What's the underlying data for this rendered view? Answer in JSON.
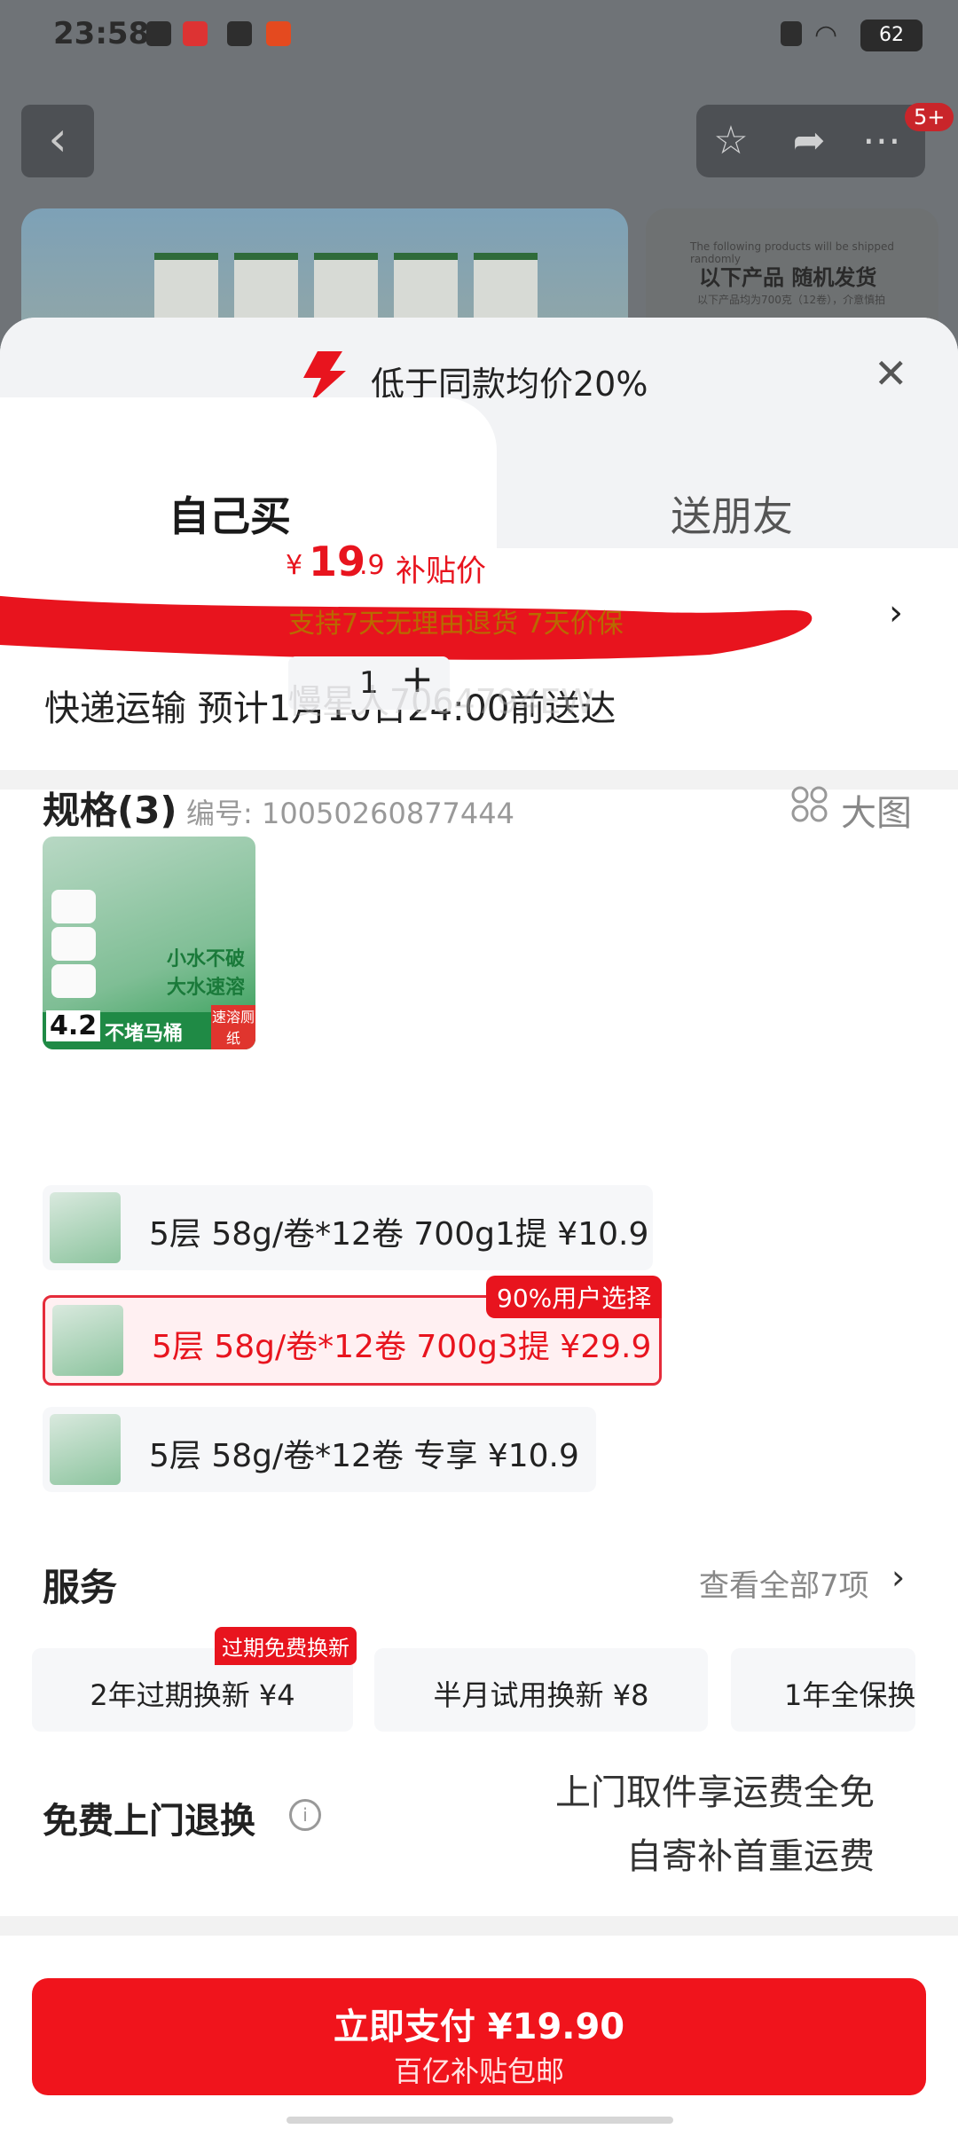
{
  "status": {
    "time": "23:58",
    "battery": "62"
  },
  "background": {
    "badge": "5+",
    "banner_right_line1": "The following products will be shipped randomly",
    "banner_right_line2": "以下产品 随机发货",
    "banner_right_line3": "以下产品均为700克（12卷），介意慎拍"
  },
  "sheet": {
    "header_title": "低于同款均价20%",
    "tabs": [
      "自己买",
      "送朋友"
    ],
    "shipping": "快递运输 预计1月10日24:00前送达"
  },
  "product": {
    "price_currency": "¥",
    "price_int": "19",
    "price_dec": ".9",
    "price_tag": "补贴价",
    "support": "支持7天无理由退货 7天价保",
    "quantity": "1",
    "watermark": "慢星人7064794EW",
    "image_text": {
      "num": "4.2",
      "bottom": "不堵马桶",
      "corner": "速溶厕纸",
      "mid": "小水不破 大水速溶"
    }
  },
  "spec": {
    "title": "规格(3)",
    "code": "编号: 10050260877444",
    "big_image": "大图",
    "badge": "90%用户选择",
    "items": [
      {
        "label": "5层 58g/卷*12卷 700g1提  ¥10.9"
      },
      {
        "label": "5层 58g/卷*12卷 700g3提  ¥29.9"
      },
      {
        "label": "5层 58g/卷*12卷 专享  ¥10.9"
      }
    ]
  },
  "service": {
    "title": "服务",
    "view_all": "查看全部7项",
    "badge": "过期免费换新",
    "cards": [
      "2年过期换新 ¥4",
      "半月试用换新 ¥8",
      "1年全保换"
    ],
    "free_title": "免费上门退换",
    "free_line1": "上门取件享运费全免",
    "free_line2": "自寄补首重运费"
  },
  "pay": {
    "main": "立即支付 ¥19.90",
    "sub": "百亿补贴包邮"
  },
  "colors": {
    "accent": "#e8141e",
    "support": "#b86a00"
  }
}
